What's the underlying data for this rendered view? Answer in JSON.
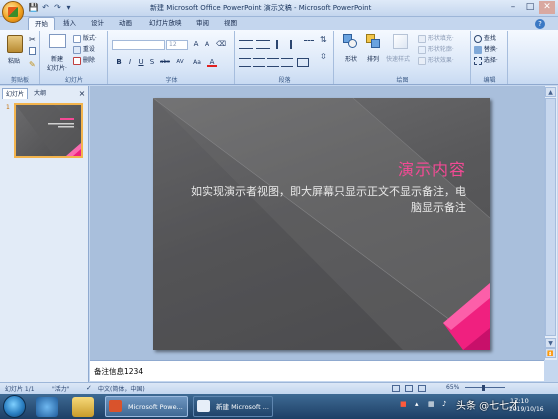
{
  "window": {
    "title": "新建 Microsoft Office PowerPoint 演示文稿 - Microsoft PowerPoint",
    "controls": [
      "–",
      "□",
      "✕"
    ]
  },
  "tabs": [
    "开始",
    "插入",
    "设计",
    "动画",
    "幻灯片放映",
    "审阅",
    "视图"
  ],
  "active_tab": "开始",
  "ribbon": {
    "clipboard": {
      "label": "剪贴板",
      "paste": "粘贴"
    },
    "slides": {
      "label": "幻灯片",
      "new_slide": "新建",
      "new_slide2": "幻灯片·",
      "layout": "版式·",
      "reset": "重设",
      "delete": "删除"
    },
    "font": {
      "label": "字体",
      "font_name": "",
      "font_size": "12",
      "buttons": [
        "B",
        "I",
        "U",
        "S",
        "abc",
        "AV",
        "Aa",
        "A"
      ]
    },
    "paragraph": {
      "label": "段落"
    },
    "drawing": {
      "label": "绘图",
      "shapes": "形状",
      "arrange": "排列",
      "quick_styles": "快速样式",
      "shape_fill": "形状填充·",
      "shape_outline": "形状轮廓·",
      "shape_effects": "形状效果·"
    },
    "editing": {
      "label": "编辑",
      "find": "查找",
      "replace": "替换·",
      "select": "选择·"
    }
  },
  "left_pane": {
    "tab_slides": "幻灯片",
    "tab_outline": "大纲",
    "close": "×",
    "thumb_number": "1"
  },
  "slide": {
    "title": "演示内容",
    "body": "如实现演示者视图，即大屏幕只显示正文不显示备注，电脑显示备注",
    "accent_color": "#f0207f"
  },
  "notes": {
    "text": "备注信息1234"
  },
  "statusbar": {
    "slide_info": "幻灯片 1/1",
    "theme": "\"活力\"",
    "language": "中文(简体，中国)",
    "zoom": "65%"
  },
  "taskbar": {
    "items": [
      "Microsoft Powe...",
      "新建 Microsoft ..."
    ],
    "time": "17:10",
    "date": "2019/10/16",
    "watermark": "头条 @七七才"
  }
}
